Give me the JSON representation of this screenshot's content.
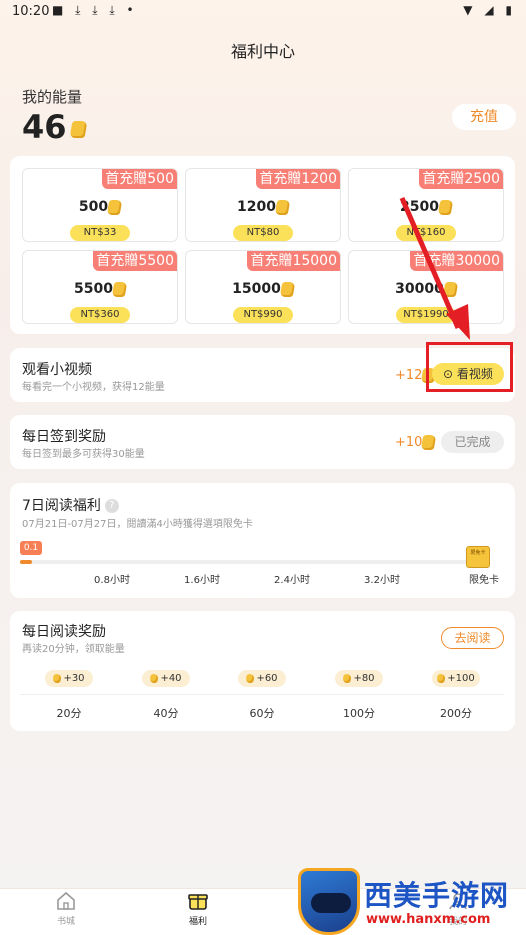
{
  "status_bar": {
    "time": "10:20",
    "left_icons": "■ ⤓ ⤓ ⤓ •",
    "right_icons": "▼ ◢ ▮"
  },
  "header": {
    "title": "福利中心"
  },
  "energy": {
    "label": "我的能量",
    "value": "46",
    "recharge_label": "充值"
  },
  "recharge_packs": [
    {
      "promo": "首充贈500",
      "amount": "500",
      "price": "NT$33"
    },
    {
      "promo": "首充贈1200",
      "amount": "1200",
      "price": "NT$80"
    },
    {
      "promo": "首充贈2500",
      "amount": "2500",
      "price": "NT$160"
    },
    {
      "promo": "首充贈5500",
      "amount": "5500",
      "price": "NT$360"
    },
    {
      "promo": "首充贈15000",
      "amount": "15000",
      "price": "NT$990"
    },
    {
      "promo": "首充贈30000",
      "amount": "30000",
      "price": "NT$1990"
    }
  ],
  "tasks": {
    "video": {
      "title": "观看小视频",
      "subtitle": "每看完一个小视频，获得12能量",
      "reward": "+12",
      "button": "看视频"
    },
    "checkin": {
      "title": "每日签到奖励",
      "subtitle": "每日签到最多可获得30能量",
      "reward": "+10",
      "button": "已完成"
    }
  },
  "read_week": {
    "title": "7日阅读福利",
    "help": "?",
    "subtitle": "07月21日-07月27日，閱讀滿4小時獲得選項限免卡",
    "progress_badge": "0.1",
    "progress_fraction": 0.025,
    "ticks": [
      "0.8小时",
      "1.6小时",
      "2.4小时",
      "3.2小时",
      "限免卡"
    ],
    "card_icon_text": "限免卡"
  },
  "daily_read": {
    "title": "每日阅读奖励",
    "subtitle": "再读20分钟，领取能量",
    "button": "去阅读",
    "rewards": [
      {
        "energy": "+30",
        "time": "20分"
      },
      {
        "energy": "+40",
        "time": "40分"
      },
      {
        "energy": "+60",
        "time": "60分"
      },
      {
        "energy": "+80",
        "time": "100分"
      },
      {
        "energy": "+100",
        "time": "200分"
      }
    ]
  },
  "tabs": [
    {
      "label": "书城"
    },
    {
      "label": "福利"
    },
    {
      "label": "我的"
    }
  ],
  "watermark": {
    "brand": "西美手游网",
    "url": "www.hanxm.com"
  },
  "colors": {
    "accent": "#f08a2a",
    "promo": "#f77f75",
    "price_pill": "#fbe05a",
    "annotation": "#e31e24"
  }
}
